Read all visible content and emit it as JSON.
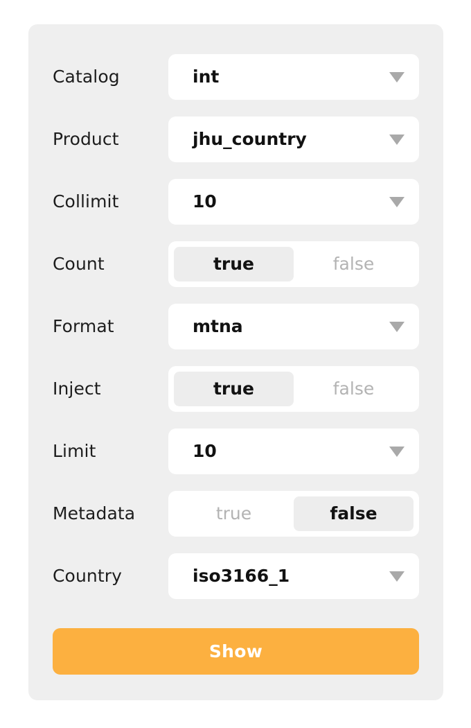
{
  "form": {
    "rows": [
      {
        "label": "Catalog",
        "type": "select",
        "value": "int",
        "icon": "chevron-down-icon"
      },
      {
        "label": "Product",
        "type": "select",
        "value": "jhu_country",
        "icon": "chevron-down-icon"
      },
      {
        "label": "Collimit",
        "type": "select",
        "value": "10",
        "icon": "chevron-down-icon"
      },
      {
        "label": "Count",
        "type": "segmented",
        "options": [
          "true",
          "false"
        ],
        "selected": "true"
      },
      {
        "label": "Format",
        "type": "select",
        "value": "mtna",
        "icon": "chevron-down-icon"
      },
      {
        "label": "Inject",
        "type": "segmented",
        "options": [
          "true",
          "false"
        ],
        "selected": "true"
      },
      {
        "label": "Limit",
        "type": "select",
        "value": "10",
        "icon": "chevron-down-icon"
      },
      {
        "label": "Metadata",
        "type": "segmented",
        "options": [
          "true",
          "false"
        ],
        "selected": "false"
      },
      {
        "label": "Country",
        "type": "select",
        "value": "iso3166_1",
        "icon": "chevron-down-icon"
      }
    ],
    "submit_label": "Show"
  },
  "colors": {
    "panel_background": "#efefef",
    "field_background": "#ffffff",
    "segment_selected": "#ededed",
    "accent": "#fcb040",
    "label_text": "#1d1d1d",
    "value_text": "#121212",
    "muted_text": "#b3b3b3",
    "caret": "#a9a9a9"
  }
}
